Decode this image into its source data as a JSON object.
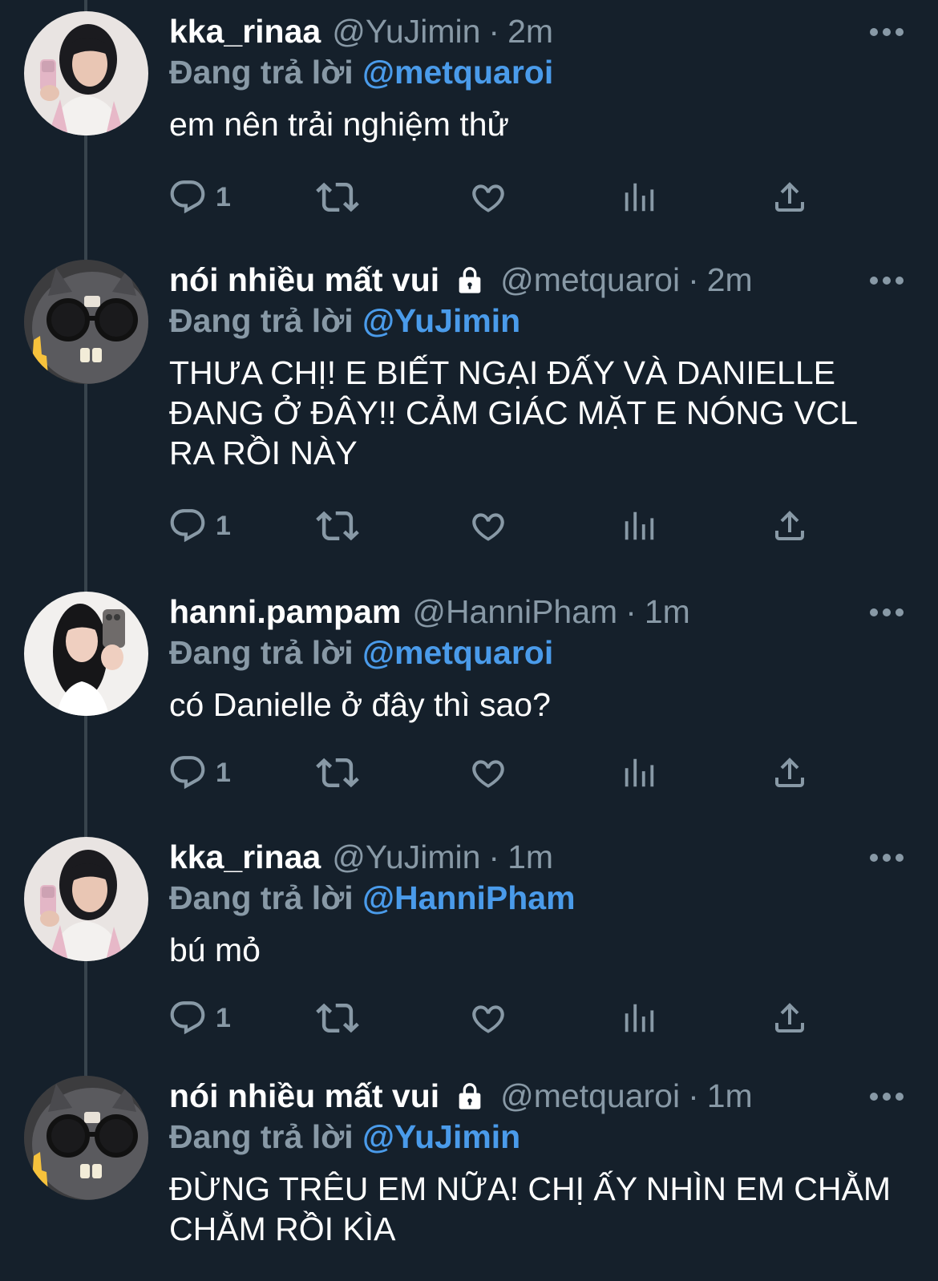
{
  "reply_prefix": "Đang trả lời",
  "tweets": [
    {
      "name": "kka_rinaa",
      "handle": "@YuJimin",
      "time": "2m",
      "locked": false,
      "replying_to": "@metquaroi",
      "text": "em nên trải nghiệm thử",
      "reply_count": "1",
      "avatar": "girl-selfie-avatar"
    },
    {
      "name": "nói nhiều mất vui",
      "handle": "@metquaroi",
      "time": "2m",
      "locked": true,
      "replying_to": "@YuJimin",
      "text": "THƯA CHỊ! E BIẾT NGẠI ĐẤY VÀ DANIELLE ĐANG Ở ĐÂY!! CẢM GIÁC MẶT E NÓNG VCL RA RỒI NÀY",
      "reply_count": "1",
      "avatar": "cat-glasses-avatar"
    },
    {
      "name": "hanni.pampam",
      "handle": "@HanniPham",
      "time": "1m",
      "locked": false,
      "replying_to": "@metquaroi",
      "text": "có Danielle ở đây thì sao?",
      "reply_count": "1",
      "avatar": "girl-phone-avatar"
    },
    {
      "name": "kka_rinaa",
      "handle": "@YuJimin",
      "time": "1m",
      "locked": false,
      "replying_to": "@HanniPham",
      "text": "bú mỏ",
      "reply_count": "1",
      "avatar": "girl-selfie-avatar"
    },
    {
      "name": "nói nhiều mất vui",
      "handle": "@metquaroi",
      "time": "1m",
      "locked": true,
      "replying_to": "@YuJimin",
      "text": "ĐỪNG TRÊU EM NỮA! CHỊ ẤY NHÌN EM CHẰM CHẰM RỒI KÌA",
      "reply_count": "",
      "avatar": "cat-glasses-avatar"
    }
  ],
  "colors": {
    "background": "#15202b",
    "muted": "#8899a6",
    "mention": "#4a9bea",
    "text": "#ffffff",
    "thread_line": "#38444d"
  },
  "icons": {
    "reply": "reply-icon",
    "retweet": "retweet-icon",
    "like": "heart-icon",
    "views": "analytics-icon",
    "share": "share-icon",
    "more": "more-icon",
    "lock": "lock-icon"
  }
}
